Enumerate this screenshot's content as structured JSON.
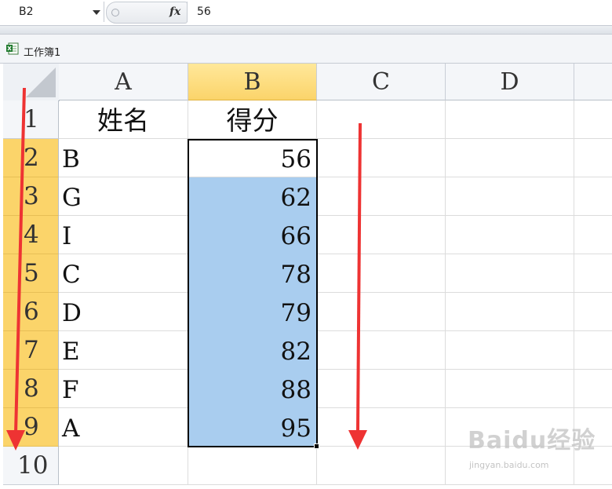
{
  "formula_bar": {
    "name_box": "B2",
    "fx_label": "fx",
    "formula_value": "56"
  },
  "workbook": {
    "title": "工作簿1",
    "icon": "excel-workbook-icon"
  },
  "columns": [
    "A",
    "B",
    "C",
    "D"
  ],
  "selected_column": "B",
  "rows": [
    {
      "num": "1",
      "a": "姓名",
      "b": "得分"
    },
    {
      "num": "2",
      "a": "B",
      "b": "56"
    },
    {
      "num": "3",
      "a": "G",
      "b": "62"
    },
    {
      "num": "4",
      "a": "I",
      "b": "66"
    },
    {
      "num": "5",
      "a": "C",
      "b": "78"
    },
    {
      "num": "6",
      "a": "D",
      "b": "79"
    },
    {
      "num": "7",
      "a": "E",
      "b": "82"
    },
    {
      "num": "8",
      "a": "F",
      "b": "88"
    },
    {
      "num": "9",
      "a": "A",
      "b": "95"
    },
    {
      "num": "10",
      "a": "",
      "b": ""
    }
  ],
  "selection": {
    "range": "B2:B9",
    "active_cell": "B2"
  },
  "colors": {
    "selection_fill": "#a9cdef",
    "header_highlight": "#fbd46a",
    "annotation_arrow": "#ee3333"
  },
  "watermark": {
    "logo": "Baidu经验",
    "url_text": "jingyan.baidu.com"
  }
}
